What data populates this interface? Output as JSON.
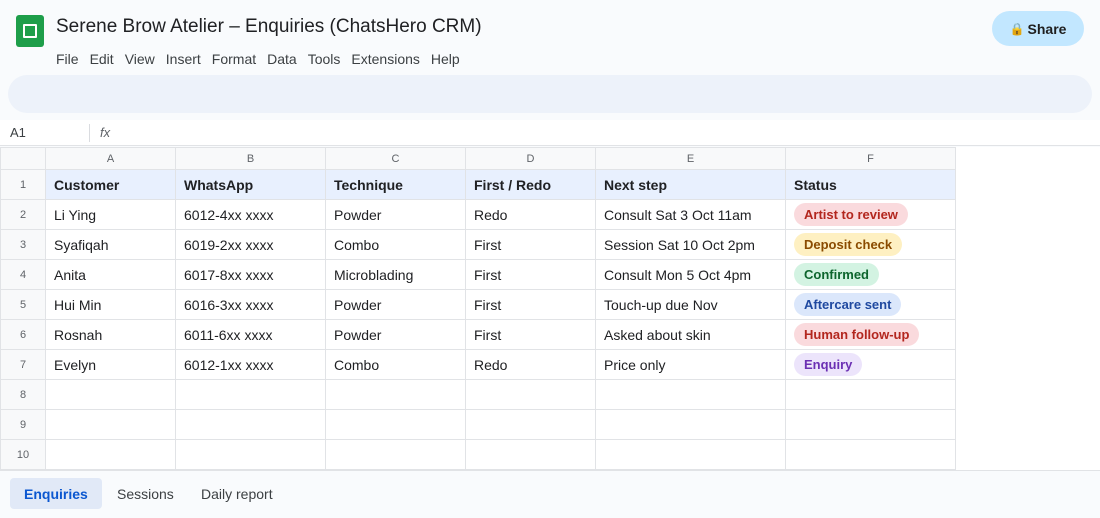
{
  "app": {
    "title": "Serene Brow Atelier – Enquiries (ChatsHero CRM)",
    "share_label": "Share",
    "share_icon": "lock-icon"
  },
  "menu": [
    "File",
    "Edit",
    "View",
    "Insert",
    "Format",
    "Data",
    "Tools",
    "Extensions",
    "Help"
  ],
  "formula_bar": {
    "cell_ref": "A1",
    "fx_label": "fx",
    "value": ""
  },
  "sheet": {
    "column_letters": [
      "A",
      "B",
      "C",
      "D",
      "E",
      "F"
    ],
    "row_numbers": [
      "1",
      "2",
      "3",
      "4",
      "5",
      "6",
      "7",
      "8",
      "9",
      "10"
    ],
    "headers": [
      "Customer",
      "WhatsApp",
      "Technique",
      "First / Redo",
      "Next step",
      "Status"
    ],
    "rows": [
      [
        "Li Ying",
        "6012-4xx xxxx",
        "Powder",
        "Redo",
        "Consult Sat 3 Oct 11am",
        "Artist to review"
      ],
      [
        "Syafiqah",
        "6019-2xx xxxx",
        "Combo",
        "First",
        "Session Sat 10 Oct 2pm",
        "Deposit check"
      ],
      [
        "Anita",
        "6017-8xx xxxx",
        "Microblading",
        "First",
        "Consult Mon 5 Oct 4pm",
        "Confirmed"
      ],
      [
        "Hui Min",
        "6016-3xx xxxx",
        "Powder",
        "First",
        "Touch-up due Nov",
        "Aftercare sent"
      ],
      [
        "Rosnah",
        "6011-6xx xxxx",
        "Powder",
        "First",
        "Asked about skin",
        "Human follow-up"
      ],
      [
        "Evelyn",
        "6012-1xx xxxx",
        "Combo",
        "Redo",
        "Price only",
        "Enquiry"
      ]
    ],
    "status_colors": {
      "Artist to review": {
        "bg": "#fadadd",
        "fg": "#b3261e"
      },
      "Deposit check": {
        "bg": "#fef0c2",
        "fg": "#8a4b00"
      },
      "Confirmed": {
        "bg": "#d3f3e2",
        "fg": "#0d652d"
      },
      "Aftercare sent": {
        "bg": "#dbe7fb",
        "fg": "#1f49a0"
      },
      "Human follow-up": {
        "bg": "#fadadd",
        "fg": "#b3261e"
      },
      "Enquiry": {
        "bg": "#ece4fb",
        "fg": "#6b2fb3"
      }
    }
  },
  "tabs": [
    {
      "label": "Enquiries",
      "active": true
    },
    {
      "label": "Sessions",
      "active": false
    },
    {
      "label": "Daily report",
      "active": false
    }
  ],
  "colors": {
    "accent": "#0b57d0",
    "share_bg": "#c2e7ff",
    "header_row_bg": "#e8f0fe",
    "logo": "#1e9e4a"
  }
}
